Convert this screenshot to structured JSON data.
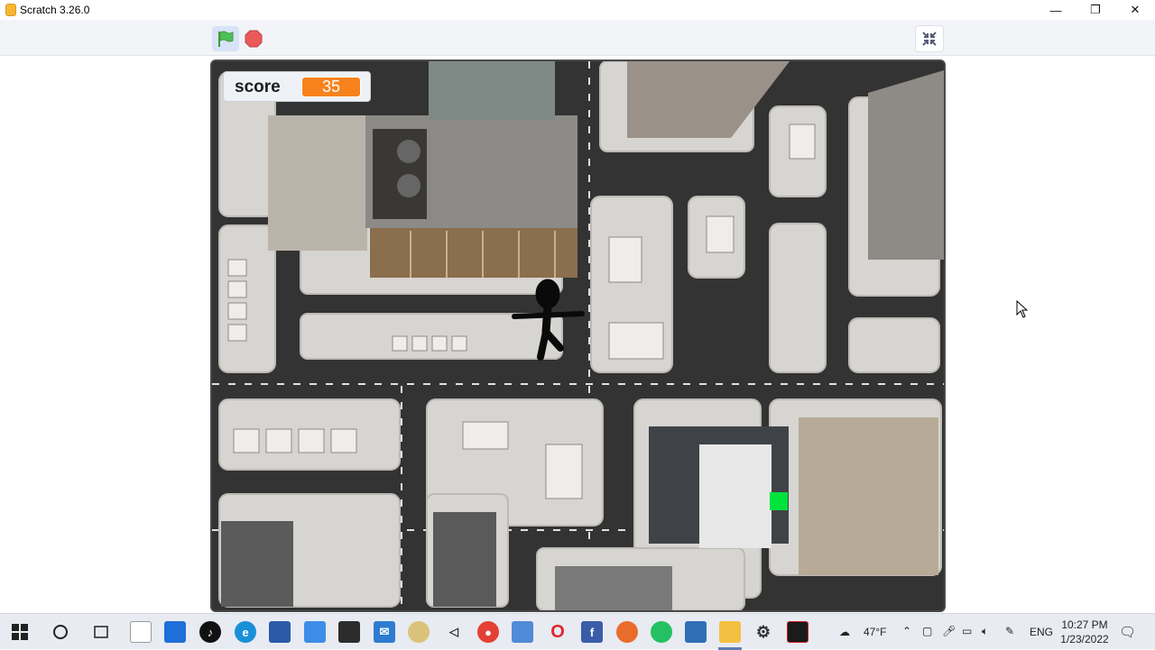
{
  "window": {
    "title": "Scratch 3.26.0",
    "minimize": "—",
    "maximize": "❐",
    "close": "✕"
  },
  "toolbar": {
    "flag_icon": "green-flag-icon",
    "stop_icon": "stop-icon",
    "fullscreen_icon": "shrink-icon"
  },
  "stage": {
    "monitor": {
      "label": "score",
      "value": "35"
    },
    "sprites": [
      "stick-figure",
      "green-square"
    ],
    "background": "aerial city map"
  },
  "taskbar": {
    "weather": "47°F",
    "language": "ENG",
    "time": "10:27 PM",
    "date": "1/23/2022",
    "apps": [
      "windows-start",
      "search",
      "task-view",
      "file",
      "store",
      "tiktok",
      "edge",
      "game-app",
      "files",
      "mail",
      "vlc",
      "visual-studio",
      "chrome",
      "remote",
      "opera",
      "facebook",
      "brave",
      "whatsapp",
      "photos",
      "scratch",
      "settings",
      "recorder"
    ]
  },
  "colors": {
    "score_orange": "#f7821b",
    "flag_green": "#4cbf56",
    "stop_red": "#ec5959",
    "sprite_green": "#00e33c"
  }
}
